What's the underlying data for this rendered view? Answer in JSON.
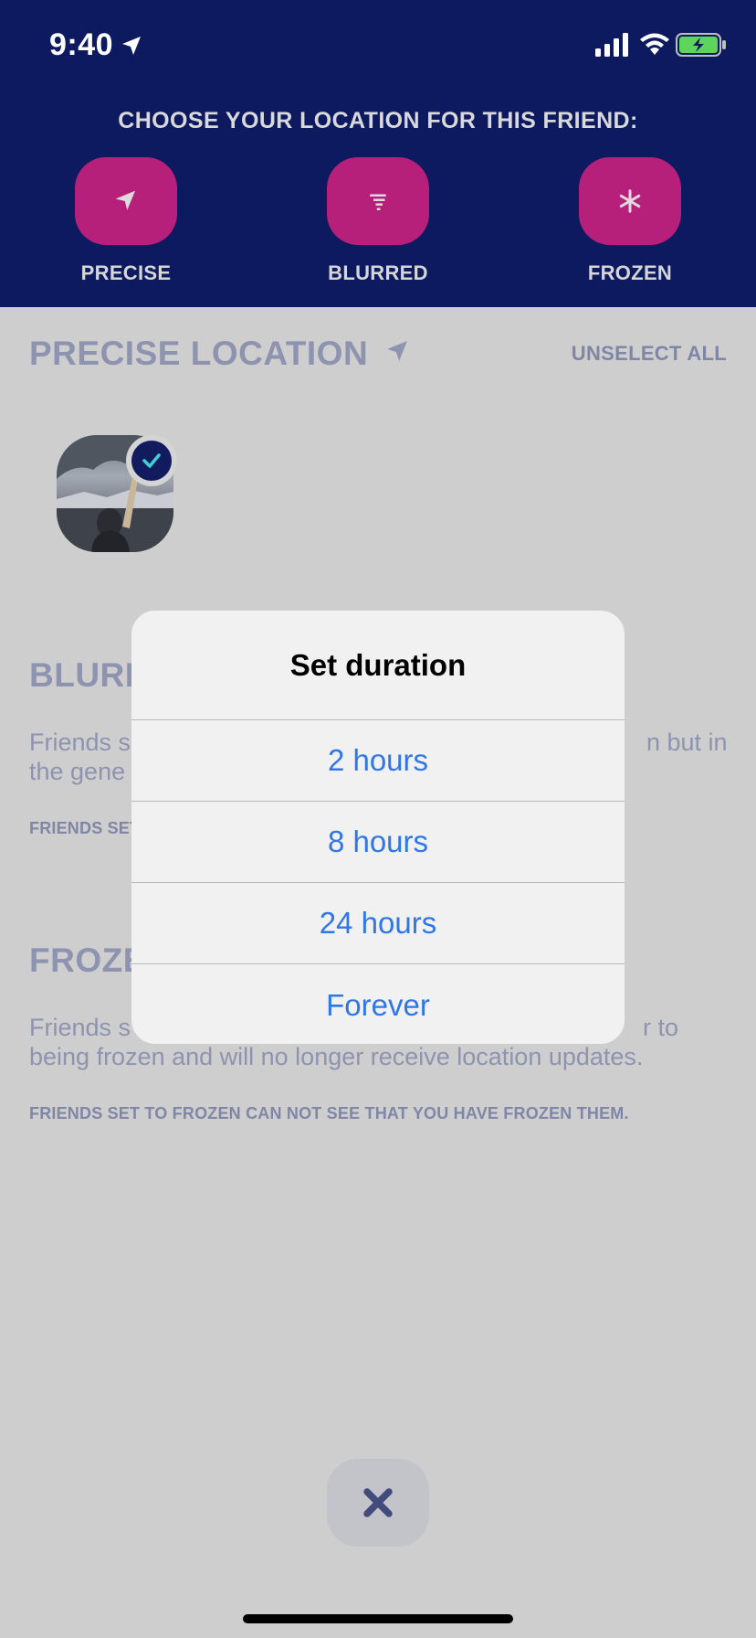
{
  "status_bar": {
    "time": "9:40"
  },
  "header": {
    "title": "CHOOSE YOUR LOCATION FOR THIS FRIEND:",
    "modes": [
      {
        "label": "PRECISE",
        "icon": "location-arrow-icon"
      },
      {
        "label": "BLURRED",
        "icon": "blurred-location-icon"
      },
      {
        "label": "FROZEN",
        "icon": "snowflake-icon"
      }
    ]
  },
  "precise_section": {
    "title": "PRECISE LOCATION",
    "unselect_all": "UNSELECT ALL"
  },
  "blurred_section": {
    "title_visible": "BLURR",
    "description_left_1": "Friends s",
    "description_right_1": "n but in",
    "description_left_2": "the gene",
    "note_visible": "FRIENDS SET"
  },
  "frozen_section": {
    "title_visible": "FROZE",
    "description_left_1": "Friends s",
    "description_right_1": "r to",
    "description_line_2": "being frozen and will no longer receive location updates.",
    "note": "FRIENDS SET TO FROZEN CAN NOT SEE THAT YOU HAVE FROZEN THEM."
  },
  "dialog": {
    "title": "Set duration",
    "options": [
      "2 hours",
      "8 hours",
      "24 hours",
      "Forever"
    ]
  },
  "colors": {
    "header_bg": "#0e1a60",
    "mode_button": "#b7207a",
    "option_text": "#2f76e6",
    "dim_overlay_bg": "#cecece"
  }
}
